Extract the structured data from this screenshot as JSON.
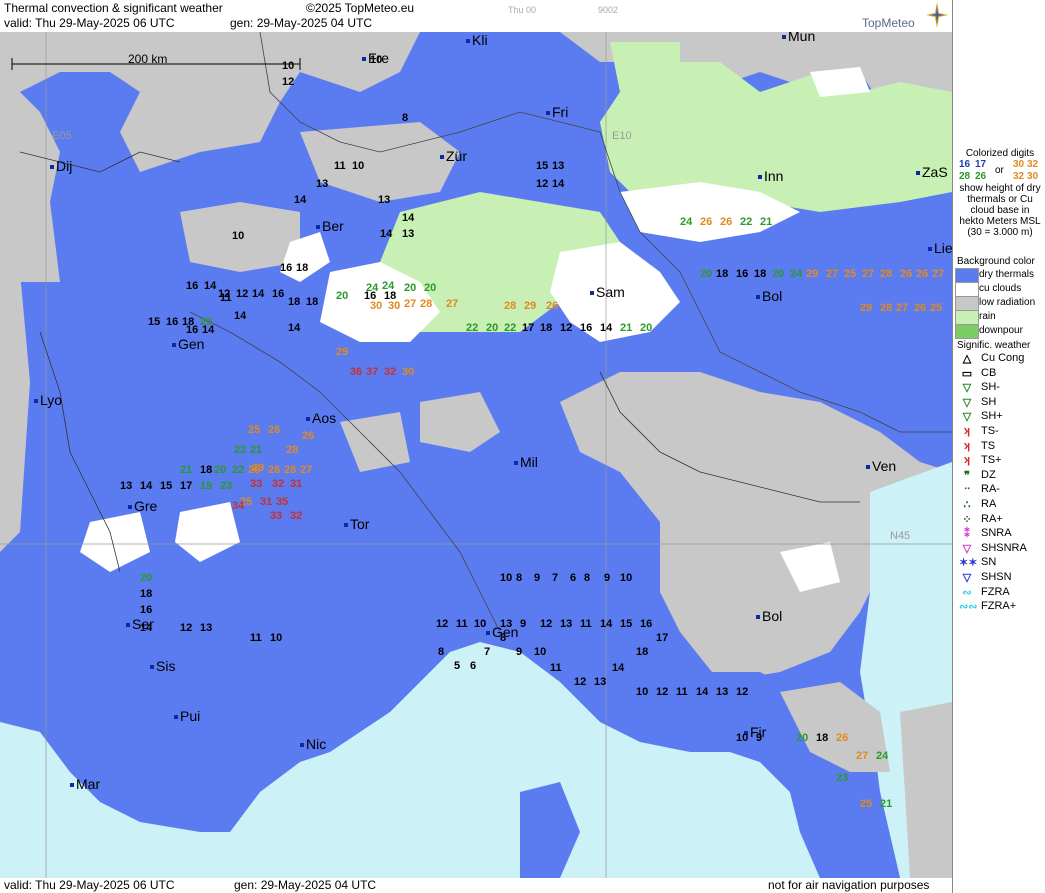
{
  "header": {
    "title": "Thermal convection & significant weather",
    "copyright": "©2025 TopMeteo.eu",
    "valid": "valid:  Thu   29-May-2025  06 UTC",
    "gen": "gen: 29-May-2025 04 UTC",
    "faint_left": "Thu 00",
    "faint_right": "9002",
    "brand": "TopMeteo"
  },
  "footer": {
    "valid": "valid:  Thu   29-May-2025   06 UTC",
    "gen": "gen: 29-May-2025 04 UTC",
    "note": "not for air navigation purposes"
  },
  "map": {
    "scale_label": "200 km",
    "grid_labels": [
      "E05",
      "E10",
      "N45"
    ],
    "cities": [
      {
        "name": "Kli"
      },
      {
        "name": "Mun"
      },
      {
        "name": "Fre"
      },
      {
        "name": "Fri"
      },
      {
        "name": "Dij"
      },
      {
        "name": "Zür"
      },
      {
        "name": "Inn"
      },
      {
        "name": "ZaS"
      },
      {
        "name": "Ber"
      },
      {
        "name": "Lie"
      },
      {
        "name": "Sam"
      },
      {
        "name": "Bol"
      },
      {
        "name": "Gen"
      },
      {
        "name": "Lyo"
      },
      {
        "name": "Aos"
      },
      {
        "name": "Mil"
      },
      {
        "name": "Ven"
      },
      {
        "name": "Gre"
      },
      {
        "name": "Tor"
      },
      {
        "name": "Ser"
      },
      {
        "name": "Gen"
      },
      {
        "name": "Bol"
      },
      {
        "name": "Sis"
      },
      {
        "name": "Pui"
      },
      {
        "name": "Nic"
      },
      {
        "name": "Fir"
      },
      {
        "name": "Mar"
      }
    ],
    "values": [
      {
        "t": "10"
      },
      {
        "t": "12"
      },
      {
        "t": "10"
      },
      {
        "t": "8"
      },
      {
        "t": "11"
      },
      {
        "t": "10"
      },
      {
        "t": "14"
      },
      {
        "t": "13"
      },
      {
        "t": "13"
      },
      {
        "t": "14"
      },
      {
        "t": "14"
      },
      {
        "t": "13"
      },
      {
        "t": "15"
      },
      {
        "t": "13"
      },
      {
        "t": "12"
      },
      {
        "t": "14"
      },
      {
        "t": "10"
      },
      {
        "t": "16"
      },
      {
        "t": "14"
      },
      {
        "t": "16"
      },
      {
        "t": "18"
      },
      {
        "t": "12"
      },
      {
        "t": "12"
      },
      {
        "t": "14"
      },
      {
        "t": "16"
      },
      {
        "t": "18"
      },
      {
        "t": "18"
      },
      {
        "t": "14"
      },
      {
        "t": "16"
      },
      {
        "t": "18"
      },
      {
        "t": "20"
      },
      {
        "t": "20"
      },
      {
        "t": "30"
      },
      {
        "t": "30"
      },
      {
        "t": "27"
      },
      {
        "t": "28"
      },
      {
        "t": "27"
      },
      {
        "t": "24"
      },
      {
        "t": "20"
      },
      {
        "t": "24"
      },
      {
        "t": "28"
      },
      {
        "t": "29"
      },
      {
        "t": "26"
      },
      {
        "t": "29"
      },
      {
        "t": "36"
      },
      {
        "t": "37"
      },
      {
        "t": "32"
      },
      {
        "t": "30"
      },
      {
        "t": "16"
      },
      {
        "t": "14"
      },
      {
        "t": "11"
      },
      {
        "t": "14"
      },
      {
        "t": "15"
      },
      {
        "t": "16"
      },
      {
        "t": "18"
      },
      {
        "t": "20"
      },
      {
        "t": "25"
      },
      {
        "t": "26"
      },
      {
        "t": "28"
      },
      {
        "t": "26"
      },
      {
        "t": "22"
      },
      {
        "t": "21"
      },
      {
        "t": "18"
      },
      {
        "t": "20"
      },
      {
        "t": "22"
      },
      {
        "t": "21"
      },
      {
        "t": "25"
      },
      {
        "t": "26"
      },
      {
        "t": "28"
      },
      {
        "t": "27"
      },
      {
        "t": "22"
      },
      {
        "t": "20"
      },
      {
        "t": "22"
      },
      {
        "t": "17"
      },
      {
        "t": "18"
      },
      {
        "t": "12"
      },
      {
        "t": "16"
      },
      {
        "t": "14"
      },
      {
        "t": "21"
      },
      {
        "t": "20"
      },
      {
        "t": "20"
      },
      {
        "t": "18"
      },
      {
        "t": "16"
      },
      {
        "t": "18"
      },
      {
        "t": "20"
      },
      {
        "t": "24"
      },
      {
        "t": "29"
      },
      {
        "t": "27"
      },
      {
        "t": "25"
      },
      {
        "t": "27"
      },
      {
        "t": "28"
      },
      {
        "t": "26"
      },
      {
        "t": "26"
      },
      {
        "t": "27"
      },
      {
        "t": "29"
      },
      {
        "t": "28"
      },
      {
        "t": "27"
      },
      {
        "t": "26"
      },
      {
        "t": "25"
      },
      {
        "t": "24"
      },
      {
        "t": "26"
      },
      {
        "t": "26"
      },
      {
        "t": "22"
      },
      {
        "t": "21"
      },
      {
        "t": "20"
      },
      {
        "t": "18"
      },
      {
        "t": "16"
      },
      {
        "t": "14"
      },
      {
        "t": "12"
      },
      {
        "t": "13"
      },
      {
        "t": "11"
      },
      {
        "t": "10"
      },
      {
        "t": "10"
      },
      {
        "t": "8"
      },
      {
        "t": "9"
      },
      {
        "t": "7"
      },
      {
        "t": "6"
      },
      {
        "t": "8"
      },
      {
        "t": "9"
      },
      {
        "t": "10"
      },
      {
        "t": "13"
      },
      {
        "t": "14"
      },
      {
        "t": "15"
      },
      {
        "t": "17"
      },
      {
        "t": "19"
      },
      {
        "t": "23"
      },
      {
        "t": "25"
      },
      {
        "t": "31"
      },
      {
        "t": "35"
      },
      {
        "t": "34"
      },
      {
        "t": "33"
      },
      {
        "t": "32"
      },
      {
        "t": "31"
      },
      {
        "t": "29"
      },
      {
        "t": "33"
      },
      {
        "t": "32"
      },
      {
        "t": "12"
      },
      {
        "t": "11"
      },
      {
        "t": "10"
      },
      {
        "t": "13"
      },
      {
        "t": "9"
      },
      {
        "t": "12"
      },
      {
        "t": "13"
      },
      {
        "t": "11"
      },
      {
        "t": "14"
      },
      {
        "t": "15"
      },
      {
        "t": "16"
      },
      {
        "t": "17"
      },
      {
        "t": "18"
      },
      {
        "t": "14"
      },
      {
        "t": "13"
      },
      {
        "t": "12"
      },
      {
        "t": "11"
      },
      {
        "t": "10"
      },
      {
        "t": "9"
      },
      {
        "t": "8"
      },
      {
        "t": "7"
      },
      {
        "t": "6"
      },
      {
        "t": "5"
      },
      {
        "t": "8"
      },
      {
        "t": "10"
      },
      {
        "t": "12"
      },
      {
        "t": "11"
      },
      {
        "t": "14"
      },
      {
        "t": "13"
      },
      {
        "t": "12"
      },
      {
        "t": "10"
      },
      {
        "t": "9"
      },
      {
        "t": "20"
      },
      {
        "t": "18"
      },
      {
        "t": "26"
      },
      {
        "t": "27"
      },
      {
        "t": "24"
      },
      {
        "t": "23"
      },
      {
        "t": "25"
      },
      {
        "t": "21"
      }
    ]
  },
  "legend": {
    "note_title": "Colorized digits",
    "note_or": "or",
    "note_text": "show height of dry thermals or Cu cloud base in hekto Meters MSL (30 = 3.000 m)",
    "note_samples": [
      "16",
      "17",
      "30",
      "32",
      "28",
      "26",
      "32",
      "30"
    ],
    "bg_title": "Background color",
    "bg_items": [
      {
        "label": "dry thermals",
        "color": "#5b7bf0"
      },
      {
        "label": "cu clouds",
        "color": "#ffffff"
      },
      {
        "label": "low radiation",
        "color": "#c8c8c8"
      },
      {
        "label": "rain",
        "color": "#c8f0b4"
      },
      {
        "label": "downpour",
        "color": "#7ccc64"
      }
    ],
    "wx_title": "Signific. weather",
    "wx_items": [
      {
        "label": "Cu Cong",
        "icon": "cu-cong-icon",
        "color": "#000000"
      },
      {
        "label": "CB",
        "icon": "cb-icon",
        "color": "#000000"
      },
      {
        "label": "SH-",
        "icon": "shower-light-icon",
        "color": "#2a8a2a"
      },
      {
        "label": "SH",
        "icon": "shower-icon",
        "color": "#2a8a2a"
      },
      {
        "label": "SH+",
        "icon": "shower-heavy-icon",
        "color": "#2a8a2a"
      },
      {
        "label": "TS-",
        "icon": "thunderstorm-light-icon",
        "color": "#d42a2a"
      },
      {
        "label": "TS",
        "icon": "thunderstorm-icon",
        "color": "#d42a2a"
      },
      {
        "label": "TS+",
        "icon": "thunderstorm-heavy-icon",
        "color": "#d42a2a"
      },
      {
        "label": "DZ",
        "icon": "drizzle-icon",
        "color": "#1e6a1e"
      },
      {
        "label": "RA-",
        "icon": "rain-light-icon",
        "color": "#1e6a1e"
      },
      {
        "label": "RA",
        "icon": "rain-icon",
        "color": "#1e6a1e"
      },
      {
        "label": "RA+",
        "icon": "rain-heavy-icon",
        "color": "#1e6a1e"
      },
      {
        "label": "SNRA",
        "icon": "sleet-icon",
        "color": "#d43ad4"
      },
      {
        "label": "SHSNRA",
        "icon": "sleet-shower-icon",
        "color": "#d43ad4"
      },
      {
        "label": "SN",
        "icon": "snow-icon",
        "color": "#2a3ad4"
      },
      {
        "label": "SHSN",
        "icon": "snow-shower-icon",
        "color": "#2a3ad4"
      },
      {
        "label": "FZRA",
        "icon": "freezing-rain-icon",
        "color": "#3acfe8"
      },
      {
        "label": "FZRA+",
        "icon": "freezing-rain-heavy-icon",
        "color": "#3acfe8"
      }
    ]
  }
}
